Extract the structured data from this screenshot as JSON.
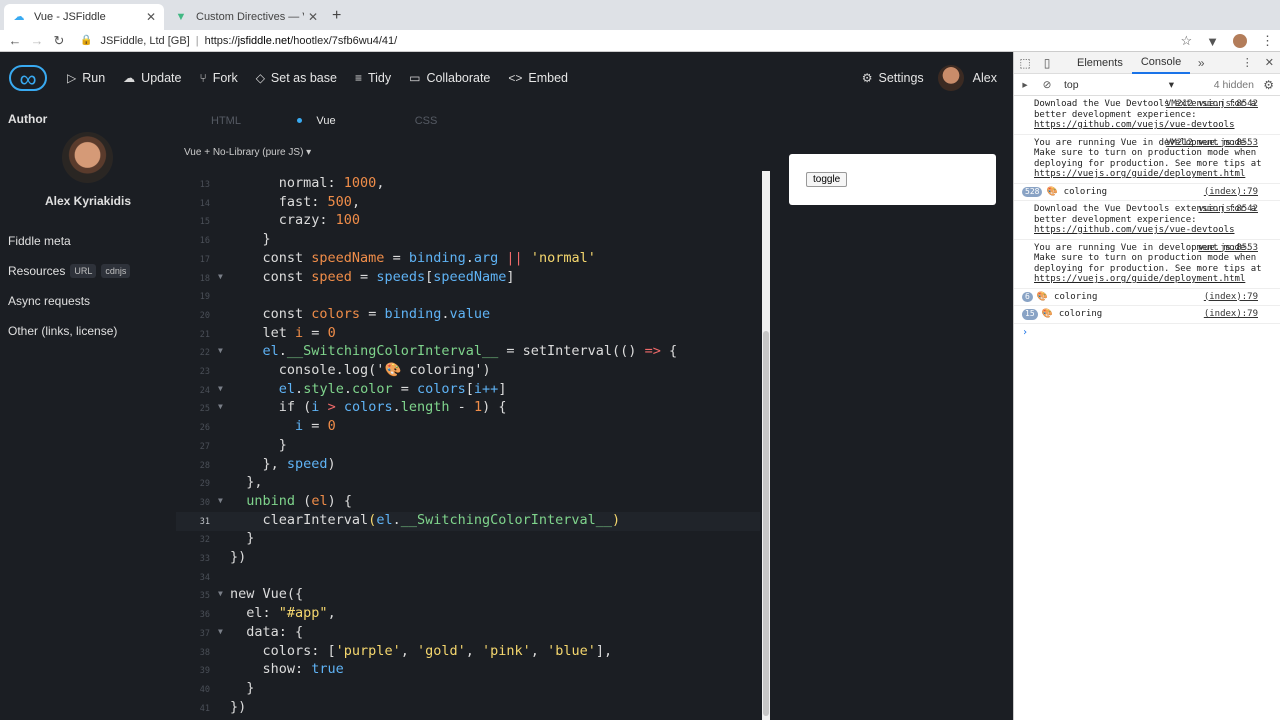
{
  "browser": {
    "tabs": [
      {
        "title": "Vue - JSFiddle",
        "icon": "jsfiddle-favicon"
      },
      {
        "title": "Custom Directives — Vue.js",
        "icon": "vue-favicon"
      }
    ],
    "site_label": "JSFiddle, Ltd [GB]",
    "url_prefix": "https://",
    "url_host": "jsfiddle.net",
    "url_path": "/hootlex/7sfb6wu4/41/"
  },
  "header": {
    "run": "Run",
    "update": "Update",
    "fork": "Fork",
    "set_as_base": "Set as base",
    "tidy": "Tidy",
    "collaborate": "Collaborate",
    "embed": "Embed",
    "settings": "Settings",
    "user": "Alex"
  },
  "sidebar": {
    "author_heading": "Author",
    "author_name": "Alex Kyriakidis",
    "fiddle_meta": "Fiddle meta",
    "resources": "Resources",
    "badge_url": "URL",
    "badge_cdnjs": "cdnjs",
    "async_requests": "Async requests",
    "other": "Other (links, license)"
  },
  "editor": {
    "tabs": [
      "HTML",
      "Vue",
      "CSS"
    ],
    "active_tab": "Vue",
    "library": "Vue + No-Library (pure JS) ▾"
  },
  "code_lines": [
    {
      "n": "13",
      "fold": false,
      "cur": false,
      "parts": [
        [
          "p",
          "      normal: "
        ],
        [
          "o",
          "1000"
        ],
        [
          "p",
          ","
        ]
      ]
    },
    {
      "n": "14",
      "fold": false,
      "cur": false,
      "parts": [
        [
          "p",
          "      fast: "
        ],
        [
          "o",
          "500"
        ],
        [
          "p",
          ","
        ]
      ]
    },
    {
      "n": "15",
      "fold": false,
      "cur": false,
      "parts": [
        [
          "p",
          "      crazy: "
        ],
        [
          "o",
          "100"
        ]
      ]
    },
    {
      "n": "16",
      "fold": false,
      "cur": false,
      "parts": [
        [
          "p",
          "    }"
        ]
      ]
    },
    {
      "n": "17",
      "fold": false,
      "cur": false,
      "parts": [
        [
          "p",
          "    const "
        ],
        [
          "o",
          "speedName"
        ],
        [
          "p",
          " = "
        ],
        [
          "b",
          "binding"
        ],
        [
          "p",
          "."
        ],
        [
          "b",
          "arg"
        ],
        [
          "p",
          " "
        ],
        [
          "r",
          "||"
        ],
        [
          "p",
          " "
        ],
        [
          "y",
          "'normal'"
        ]
      ]
    },
    {
      "n": "18",
      "fold": true,
      "cur": false,
      "parts": [
        [
          "p",
          "    const "
        ],
        [
          "o",
          "speed"
        ],
        [
          "p",
          " = "
        ],
        [
          "b",
          "speeds"
        ],
        [
          "p",
          "["
        ],
        [
          "b",
          "speedName"
        ],
        [
          "p",
          "]"
        ]
      ]
    },
    {
      "n": "19",
      "fold": false,
      "cur": false,
      "parts": [
        [
          "p",
          ""
        ]
      ]
    },
    {
      "n": "20",
      "fold": false,
      "cur": false,
      "parts": [
        [
          "p",
          "    const "
        ],
        [
          "o",
          "colors"
        ],
        [
          "p",
          " = "
        ],
        [
          "b",
          "binding"
        ],
        [
          "p",
          "."
        ],
        [
          "b",
          "value"
        ]
      ]
    },
    {
      "n": "21",
      "fold": false,
      "cur": false,
      "parts": [
        [
          "p",
          "    let "
        ],
        [
          "o",
          "i"
        ],
        [
          "p",
          " = "
        ],
        [
          "o",
          "0"
        ]
      ]
    },
    {
      "n": "22",
      "fold": true,
      "cur": false,
      "parts": [
        [
          "p",
          "    "
        ],
        [
          "b",
          "el"
        ],
        [
          "p",
          "."
        ],
        [
          "g",
          "__SwitchingColorInterval__"
        ],
        [
          "p",
          " = setInterval(() "
        ],
        [
          "r",
          "=>"
        ],
        [
          "p",
          " {"
        ]
      ]
    },
    {
      "n": "23",
      "fold": false,
      "cur": false,
      "parts": [
        [
          "p",
          "      console.log('"
        ],
        [
          "e",
          "🎨"
        ],
        [
          "p",
          " coloring')"
        ]
      ]
    },
    {
      "n": "24",
      "fold": true,
      "cur": false,
      "parts": [
        [
          "p",
          "      "
        ],
        [
          "b",
          "el"
        ],
        [
          "p",
          "."
        ],
        [
          "g",
          "style"
        ],
        [
          "p",
          "."
        ],
        [
          "g",
          "color"
        ],
        [
          "p",
          " = "
        ],
        [
          "b",
          "colors"
        ],
        [
          "p",
          "["
        ],
        [
          "b",
          "i++"
        ],
        [
          "p",
          "]"
        ]
      ]
    },
    {
      "n": "25",
      "fold": true,
      "cur": false,
      "parts": [
        [
          "p",
          "      if ("
        ],
        [
          "b",
          "i"
        ],
        [
          "p",
          " "
        ],
        [
          "r",
          ">"
        ],
        [
          "p",
          " "
        ],
        [
          "b",
          "colors"
        ],
        [
          "p",
          "."
        ],
        [
          "g",
          "length"
        ],
        [
          "p",
          " - "
        ],
        [
          "o",
          "1"
        ],
        [
          "p",
          ") {"
        ]
      ]
    },
    {
      "n": "26",
      "fold": false,
      "cur": false,
      "parts": [
        [
          "p",
          "        "
        ],
        [
          "b",
          "i"
        ],
        [
          "p",
          " = "
        ],
        [
          "o",
          "0"
        ]
      ]
    },
    {
      "n": "27",
      "fold": false,
      "cur": false,
      "parts": [
        [
          "p",
          "      }"
        ]
      ]
    },
    {
      "n": "28",
      "fold": false,
      "cur": false,
      "parts": [
        [
          "p",
          "    }, "
        ],
        [
          "b",
          "speed"
        ],
        [
          "p",
          ")"
        ]
      ]
    },
    {
      "n": "29",
      "fold": false,
      "cur": false,
      "parts": [
        [
          "p",
          "  },"
        ]
      ]
    },
    {
      "n": "30",
      "fold": true,
      "cur": false,
      "parts": [
        [
          "p",
          "  "
        ],
        [
          "g",
          "unbind"
        ],
        [
          "p",
          " ("
        ],
        [
          "o",
          "el"
        ],
        [
          "p",
          ") {"
        ]
      ]
    },
    {
      "n": "31",
      "fold": false,
      "cur": true,
      "parts": [
        [
          "p",
          "    clearInterval"
        ],
        [
          "y",
          "("
        ],
        [
          "b",
          "el"
        ],
        [
          "p",
          "."
        ],
        [
          "g",
          "__SwitchingColorInterval__"
        ],
        [
          "y",
          ")"
        ]
      ]
    },
    {
      "n": "32",
      "fold": false,
      "cur": false,
      "parts": [
        [
          "p",
          "  }"
        ]
      ]
    },
    {
      "n": "33",
      "fold": false,
      "cur": false,
      "parts": [
        [
          "p",
          "})"
        ]
      ]
    },
    {
      "n": "34",
      "fold": false,
      "cur": false,
      "parts": [
        [
          "p",
          ""
        ]
      ]
    },
    {
      "n": "35",
      "fold": true,
      "cur": false,
      "parts": [
        [
          "p",
          "new Vue({"
        ]
      ]
    },
    {
      "n": "36",
      "fold": false,
      "cur": false,
      "parts": [
        [
          "p",
          "  el: "
        ],
        [
          "y",
          "\"#app\""
        ],
        [
          "p",
          ","
        ]
      ]
    },
    {
      "n": "37",
      "fold": true,
      "cur": false,
      "parts": [
        [
          "p",
          "  data: {"
        ]
      ]
    },
    {
      "n": "38",
      "fold": false,
      "cur": false,
      "parts": [
        [
          "p",
          "    colors: ["
        ],
        [
          "y",
          "'purple'"
        ],
        [
          "p",
          ", "
        ],
        [
          "y",
          "'gold'"
        ],
        [
          "p",
          ", "
        ],
        [
          "y",
          "'pink'"
        ],
        [
          "p",
          ", "
        ],
        [
          "y",
          "'blue'"
        ],
        [
          "p",
          "],"
        ]
      ]
    },
    {
      "n": "39",
      "fold": false,
      "cur": false,
      "parts": [
        [
          "p",
          "    show: "
        ],
        [
          "b",
          "true"
        ]
      ]
    },
    {
      "n": "40",
      "fold": false,
      "cur": false,
      "parts": [
        [
          "p",
          "  }"
        ]
      ]
    },
    {
      "n": "41",
      "fold": false,
      "cur": false,
      "parts": [
        [
          "p",
          "})"
        ]
      ]
    }
  ],
  "result": {
    "toggle_label": "toggle"
  },
  "devtools": {
    "tab_elements": "Elements",
    "tab_console": "Console",
    "context": "top",
    "hidden": "4 hidden",
    "messages": [
      {
        "count": "",
        "text": "Download the Vue Devtools extension for a better development experience:",
        "link": "https://github.com/vuejs/vue-devtools",
        "src": "VM212 vue.js:8542"
      },
      {
        "count": "",
        "text": "You are running Vue in development mode. Make sure to turn on production mode when deploying for production. See more tips at",
        "link": "https://vuejs.org/guide/deployment.html",
        "src": "VM212 vue.js:8553"
      },
      {
        "count": "528",
        "text": "coloring",
        "link": "",
        "src": "(index):79"
      },
      {
        "count": "",
        "text": "Download the Vue Devtools extension for a better development experience:",
        "link": "https://github.com/vuejs/vue-devtools",
        "src": "vue.js:8542"
      },
      {
        "count": "",
        "text": "You are running Vue in development mode. Make sure to turn on production mode when deploying for production. See more tips at",
        "link": "https://vuejs.org/guide/deployment.html",
        "src": "vue.js:8553"
      },
      {
        "count": "6",
        "text": "coloring",
        "link": "",
        "src": "(index):79"
      },
      {
        "count": "15",
        "text": "coloring",
        "link": "",
        "src": "(index):79"
      }
    ]
  }
}
